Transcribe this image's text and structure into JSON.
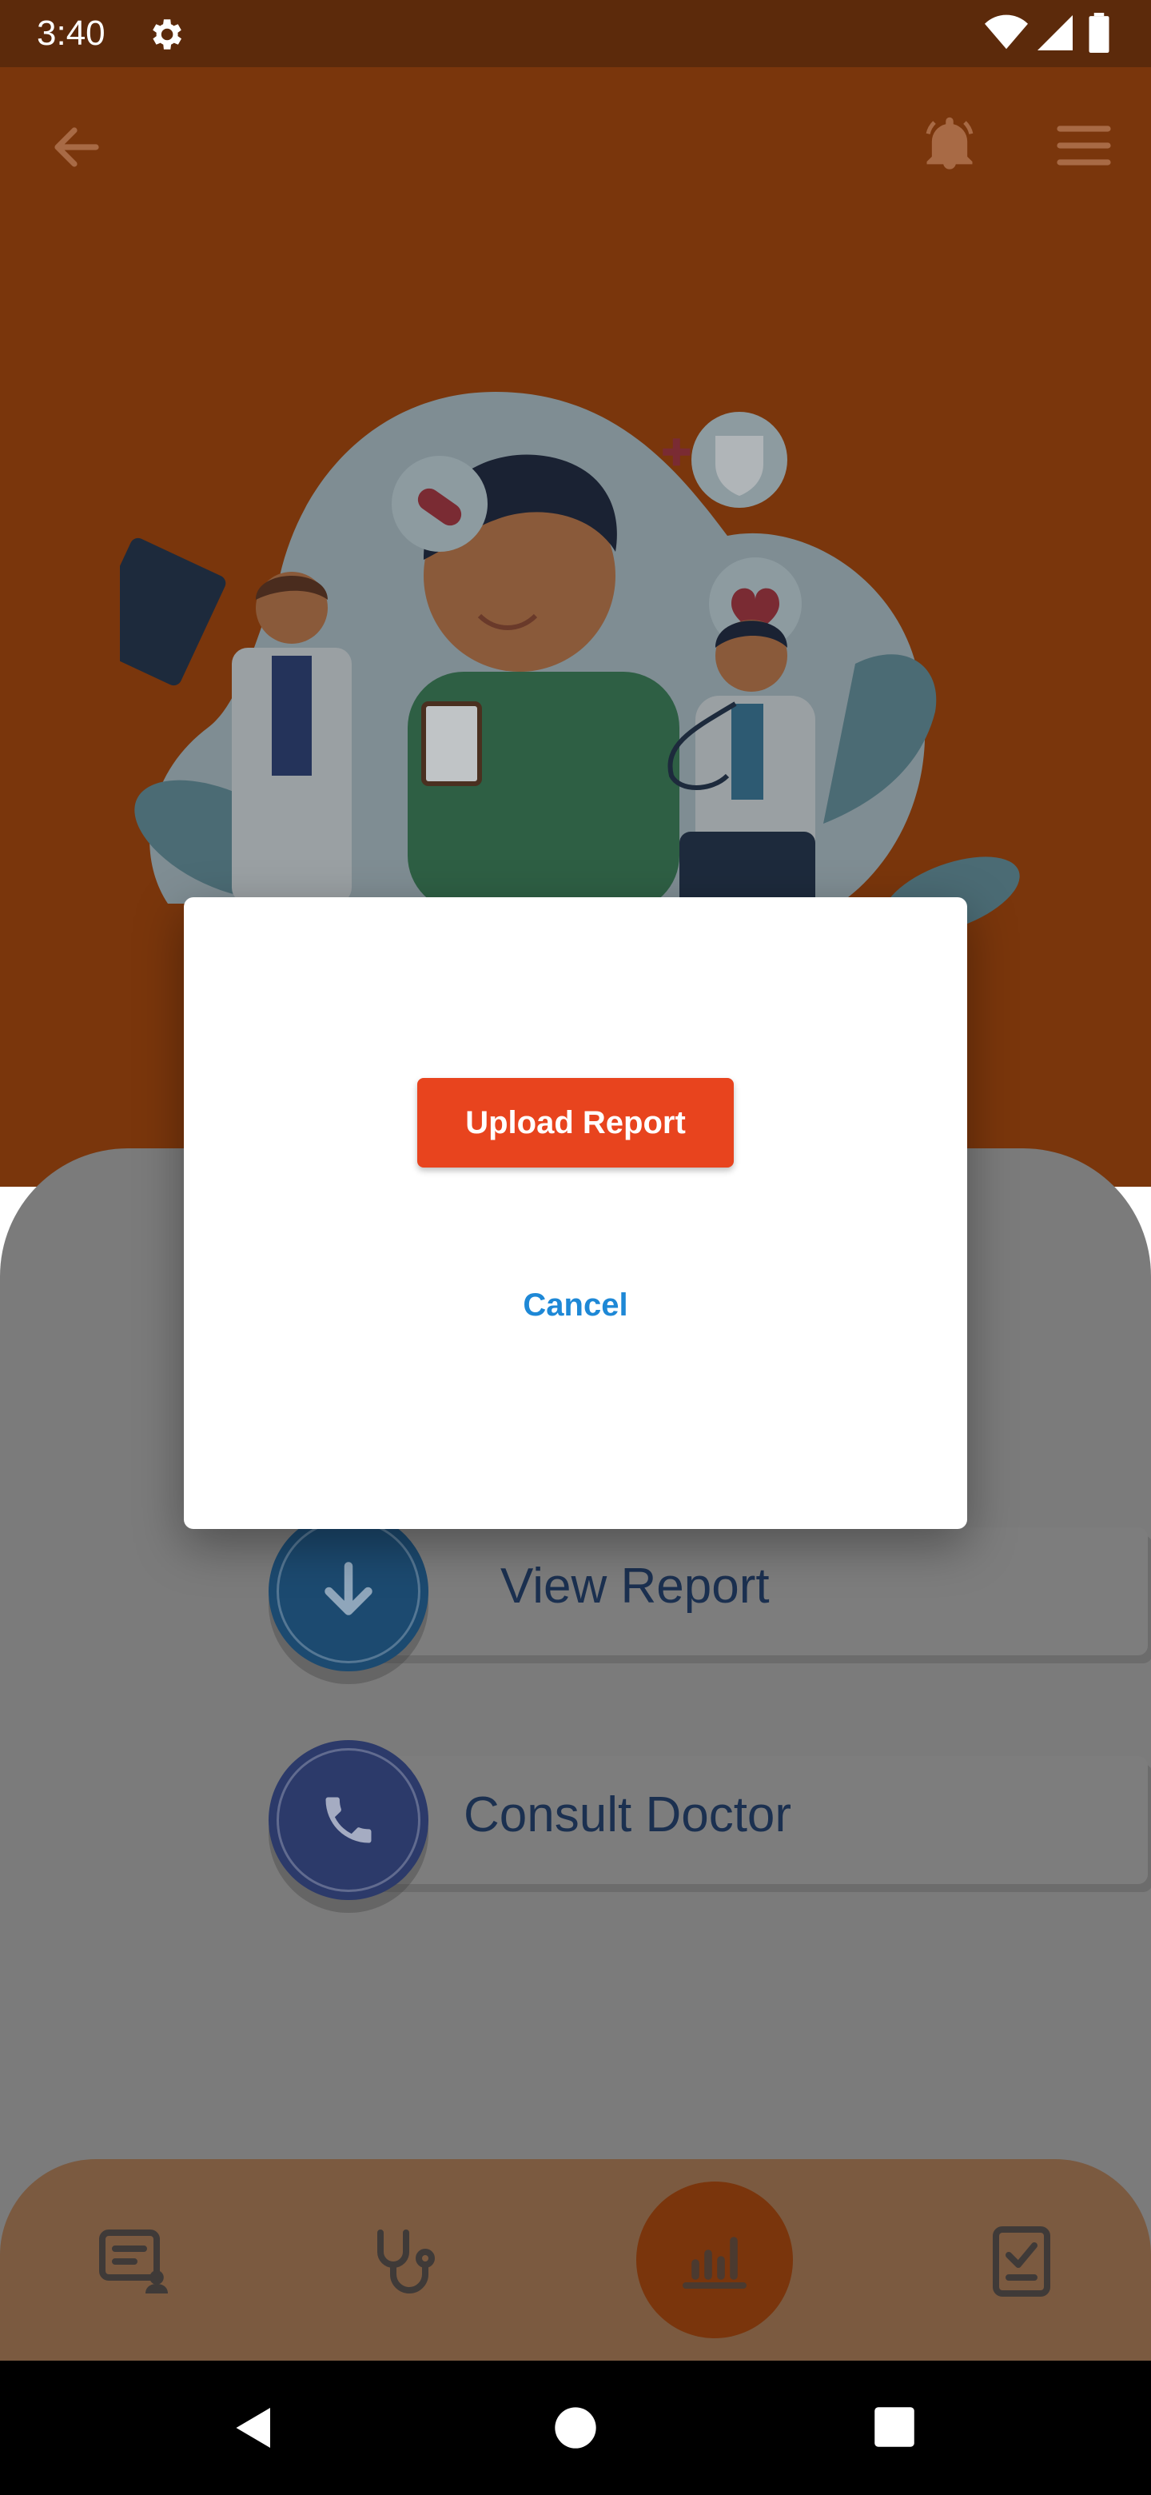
{
  "status_bar": {
    "time": "3:40",
    "icons": [
      "gear-icon",
      "wifi-icon",
      "signal-icon",
      "battery-icon"
    ]
  },
  "top_bar": {
    "icons": [
      "back-arrow-icon",
      "notification-bell-icon",
      "hamburger-menu-icon"
    ]
  },
  "background_actions": [
    {
      "label": "View Report",
      "icon": "download-arrow-icon"
    },
    {
      "label": "Consult Doctor",
      "icon": "phone-icon"
    }
  ],
  "bottom_nav": {
    "items": [
      {
        "icon": "patient-record-icon"
      },
      {
        "icon": "stethoscope-icon"
      },
      {
        "icon": "report-chart-icon",
        "active": true
      },
      {
        "icon": "checklist-icon"
      }
    ]
  },
  "dialog": {
    "primary_label": "Upload Report",
    "secondary_label": "Cancel"
  },
  "system_nav": {
    "icons": [
      "back-triangle-icon",
      "home-circle-icon",
      "recents-square-icon"
    ]
  },
  "colors": {
    "status_bar": "#5c2a0b",
    "hero_bg": "#7a360c",
    "primary_button": "#e8441e",
    "cancel_text": "#1e88d6",
    "dim_overlay": "#7b7b7b"
  }
}
